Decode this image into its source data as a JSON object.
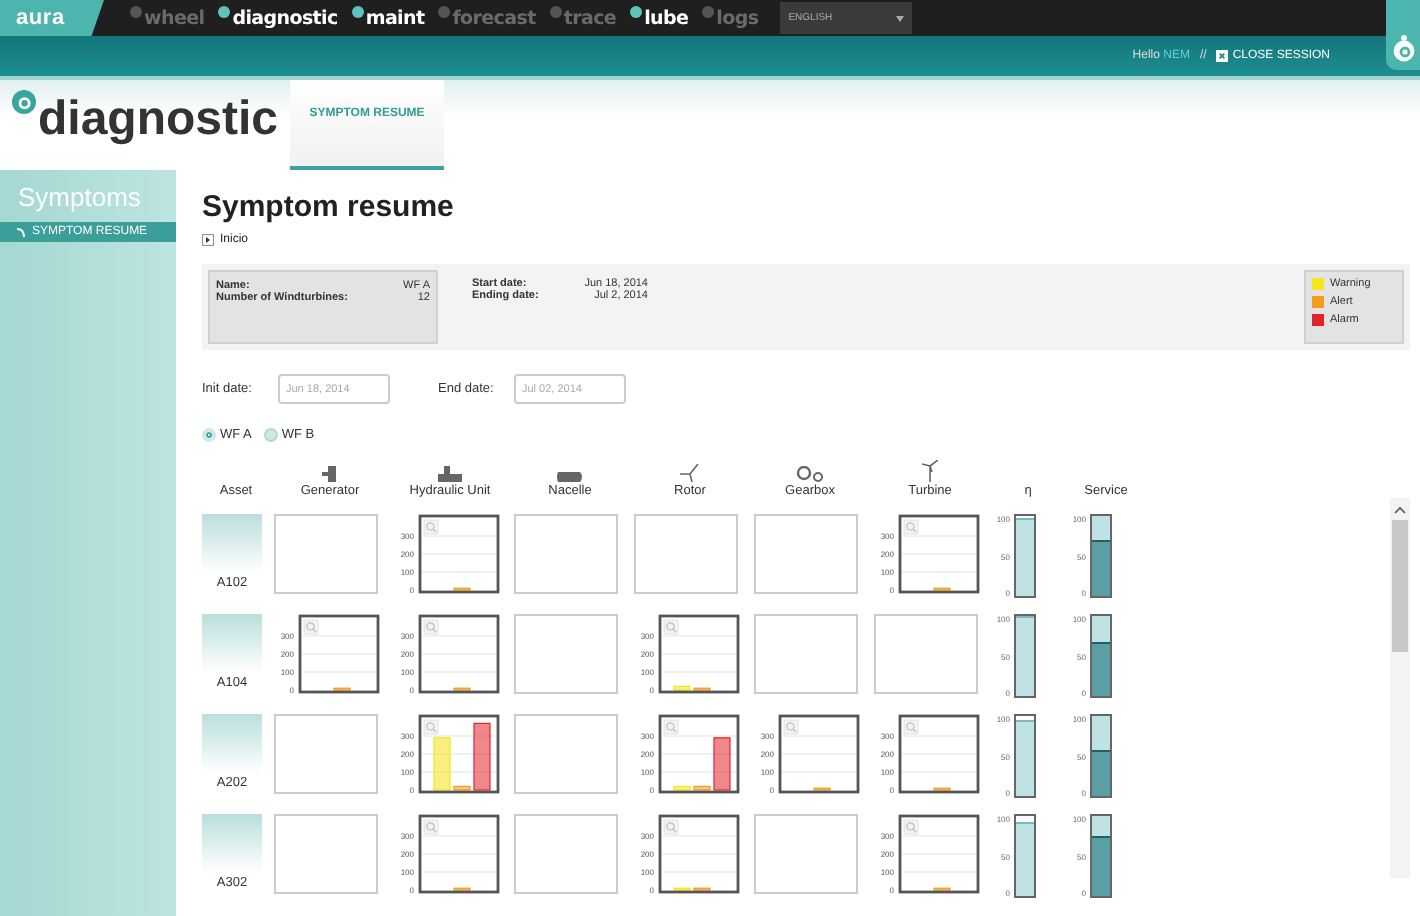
{
  "nav": {
    "logo": "aura",
    "items": [
      {
        "label": "wheel",
        "disabled": true
      },
      {
        "label": "diagnostic",
        "disabled": false
      },
      {
        "label": "maint",
        "disabled": false
      },
      {
        "label": "forecast",
        "disabled": true
      },
      {
        "label": "trace",
        "disabled": true
      },
      {
        "label": "lube",
        "disabled": false
      },
      {
        "label": "logs",
        "disabled": true
      }
    ],
    "language": "ENGLISH"
  },
  "session": {
    "greeting": "Hello",
    "user": "NEM",
    "separator": "//",
    "close": "CLOSE SESSION"
  },
  "header": {
    "title": "diagnostic",
    "tabs": [
      {
        "label": "SYMPTOM RESUME",
        "selected": true
      }
    ]
  },
  "sidebar": {
    "title": "Symptoms",
    "items": [
      {
        "label": "SYMPTOM RESUME",
        "selected": true
      }
    ]
  },
  "page": {
    "title": "Symptom resume",
    "breadcrumb": "Inicio"
  },
  "summary": {
    "fields": [
      {
        "label": "Name:",
        "value": "WF A"
      },
      {
        "label": "Number of Windturbines:",
        "value": "12"
      }
    ],
    "dates": [
      {
        "label": "Start date:",
        "value": "Jun 18, 2014"
      },
      {
        "label": "Ending date:",
        "value": "Jul 2, 2014"
      }
    ],
    "legend": [
      {
        "label": "Warning",
        "color": "#f2e61c"
      },
      {
        "label": "Alert",
        "color": "#f39c1e"
      },
      {
        "label": "Alarm",
        "color": "#e3242b"
      }
    ]
  },
  "filters": [
    {
      "label": "Init date:",
      "placeholder": "Jun 18, 2014"
    },
    {
      "label": "End date:",
      "placeholder": "Jul 02, 2014"
    }
  ],
  "farms": [
    {
      "label": "WF A",
      "selected": true
    },
    {
      "label": "WF B",
      "selected": false
    }
  ],
  "table": {
    "columns": [
      "Asset",
      "Generator",
      "Hydraulic Unit",
      "Nacelle",
      "Rotor",
      "Gearbox",
      "Turbine",
      "η",
      "Service"
    ],
    "rows": [
      {
        "asset": "A102",
        "cells": [
          {
            "kind": "empty"
          },
          {
            "kind": "chart",
            "chart_data": {
              "type": "bar",
              "values": [
                0,
                10,
                0
              ],
              "ylim": [
                0,
                400
              ],
              "yticks": [
                0,
                100,
                200,
                300
              ],
              "grid": true
            }
          },
          {
            "kind": "empty"
          },
          {
            "kind": "empty"
          },
          {
            "kind": "empty"
          },
          {
            "kind": "chart",
            "chart_data": {
              "type": "bar",
              "values": [
                0,
                10,
                0
              ],
              "ylim": [
                0,
                400
              ],
              "yticks": [
                0,
                100,
                200,
                300
              ],
              "grid": true
            }
          }
        ],
        "eta": {
          "level": 0.95,
          "ticks": [
            "100",
            "50",
            "0"
          ]
        },
        "service": {
          "level": 0.68,
          "ticks": [
            "100",
            "50",
            "0"
          ]
        }
      },
      {
        "asset": "A104",
        "cells": [
          {
            "kind": "chart",
            "chart_data": {
              "type": "bar",
              "values": [
                0,
                10,
                0
              ],
              "ylim": [
                0,
                400
              ],
              "yticks": [
                0,
                100,
                200,
                300
              ],
              "grid": true
            }
          },
          {
            "kind": "chart",
            "chart_data": {
              "type": "bar",
              "values": [
                0,
                10,
                0
              ],
              "ylim": [
                0,
                400
              ],
              "yticks": [
                0,
                100,
                200,
                300
              ],
              "grid": true
            }
          },
          {
            "kind": "empty"
          },
          {
            "kind": "chart",
            "chart_data": {
              "type": "bar",
              "values": [
                20,
                10,
                0
              ],
              "ylim": [
                0,
                400
              ],
              "yticks": [
                0,
                100,
                200,
                300
              ],
              "grid": true
            }
          },
          {
            "kind": "empty"
          },
          {
            "kind": "empty"
          }
        ],
        "eta": {
          "level": 0.98,
          "ticks": [
            "100",
            "50",
            "0"
          ]
        },
        "service": {
          "level": 0.64,
          "ticks": [
            "100",
            "50",
            "0"
          ]
        }
      },
      {
        "asset": "A202",
        "cells": [
          {
            "kind": "empty"
          },
          {
            "kind": "chart",
            "chart_data": {
              "type": "bar",
              "values": [
                290,
                20,
                370
              ],
              "ylim": [
                0,
                400
              ],
              "yticks": [
                0,
                100,
                200,
                300
              ],
              "grid": true
            }
          },
          {
            "kind": "empty"
          },
          {
            "kind": "chart",
            "chart_data": {
              "type": "bar",
              "values": [
                20,
                20,
                290
              ],
              "ylim": [
                0,
                400
              ],
              "yticks": [
                0,
                100,
                200,
                300
              ],
              "grid": true
            }
          },
          {
            "kind": "chart",
            "chart_data": {
              "type": "bar",
              "values": [
                0,
                10,
                0
              ],
              "ylim": [
                0,
                400
              ],
              "yticks": [
                0,
                100,
                200,
                300
              ],
              "grid": true
            }
          },
          {
            "kind": "chart",
            "chart_data": {
              "type": "bar",
              "values": [
                0,
                10,
                0
              ],
              "ylim": [
                0,
                400
              ],
              "yticks": [
                0,
                100,
                200,
                300
              ],
              "grid": true
            }
          }
        ],
        "eta": {
          "level": 0.93,
          "ticks": [
            "100",
            "50",
            "0"
          ]
        },
        "service": {
          "level": 0.55,
          "ticks": [
            "100",
            "50",
            "0"
          ]
        }
      },
      {
        "asset": "A302",
        "cells": [
          {
            "kind": "empty"
          },
          {
            "kind": "chart",
            "chart_data": {
              "type": "bar",
              "values": [
                0,
                10,
                0
              ],
              "ylim": [
                0,
                400
              ],
              "yticks": [
                0,
                100,
                200,
                300
              ],
              "grid": true
            }
          },
          {
            "kind": "empty"
          },
          {
            "kind": "chart",
            "chart_data": {
              "type": "bar",
              "values": [
                10,
                10,
                0
              ],
              "ylim": [
                0,
                400
              ],
              "yticks": [
                0,
                100,
                200,
                300
              ],
              "grid": true
            }
          },
          {
            "kind": "empty"
          },
          {
            "kind": "chart",
            "chart_data": {
              "type": "bar",
              "values": [
                0,
                10,
                0
              ],
              "ylim": [
                0,
                400
              ],
              "yticks": [
                0,
                100,
                200,
                300
              ],
              "grid": true
            }
          }
        ],
        "eta": {
          "level": 0.9,
          "ticks": [
            "100",
            "50",
            "0"
          ]
        },
        "service": {
          "level": 0.72,
          "ticks": [
            "100",
            "50",
            "0"
          ]
        }
      }
    ]
  }
}
